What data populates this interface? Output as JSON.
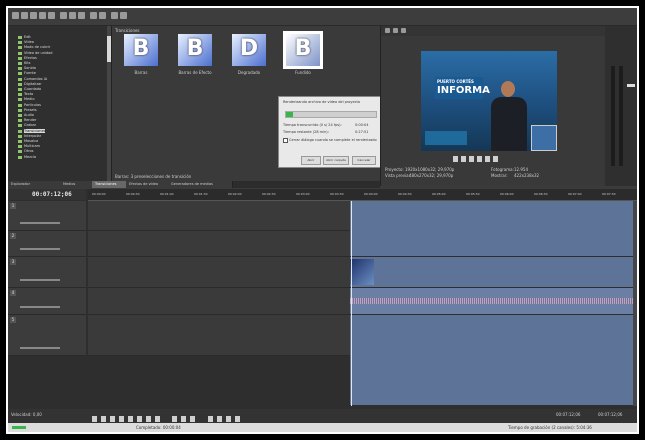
{
  "explorer": {
    "tree": [
      "Edit",
      "Vídeo",
      "Modo de cubrir",
      "Vídeo de unidad",
      "Efectos",
      "Kits",
      "Sonido",
      "Fuente",
      "Comandos IA",
      "Digitalizar",
      "Guardado",
      "Texto",
      "Medio",
      "Particulas",
      "Presets",
      "Audio",
      "Render",
      "Grabar",
      "Transiciones",
      "Interpolar",
      "Mosaico",
      "Multicam",
      "Otros",
      "Mezcla"
    ],
    "selected_index": 18
  },
  "transitions": {
    "header": "Transiciones",
    "items": [
      {
        "letter": "B",
        "label": "Barras"
      },
      {
        "letter": "B",
        "label": "Barras de Efecto"
      },
      {
        "letter": "D",
        "label": "Degradado"
      },
      {
        "letter": "B",
        "label": "Fundido"
      }
    ],
    "footer": "Barras: 3 preselecciones de transición"
  },
  "dialog": {
    "title": "Renderizando archivo de vídeo del proyecto",
    "progress": 0.08,
    "rows": [
      {
        "label": "Tiempo transcurrido (0 s/ 24 fps):",
        "value": "0:00:04"
      },
      {
        "label": "Tiempo restante (28 min):",
        "value": "0:27:51"
      }
    ],
    "checkbox_label": "Cerrar diálogo cuando se complete el renderizado",
    "buttons": [
      "Abrir",
      "Abrir carpeta",
      "Cancelar"
    ]
  },
  "preview": {
    "banner_line1": "PUERTO CORTÉS",
    "banner_line2": "INFORMA",
    "project_label": "Proyecto:",
    "project_value": "1920x1080x32; 29,970p",
    "preview_label": "Vista previa:",
    "preview_value": "480x270x32; 29,970p",
    "frame_label": "Fotograma:",
    "frame_value": "12.954",
    "display_label": "Mostrar:",
    "display_value": "422x238x32"
  },
  "tabs": [
    "Explorador",
    "Medios",
    "Transiciones",
    "Efectos de vídeo",
    "Generadores de medios"
  ],
  "active_tab": 2,
  "timeline": {
    "timecode": "00:07:12;06",
    "ruler_ticks": [
      "00:00:00",
      "00:00:30",
      "00:01:00",
      "00:01:30",
      "00:02:00",
      "00:02:30",
      "00:03:00",
      "00:03:30",
      "00:04:00",
      "00:04:30",
      "00:05:00",
      "00:05:30",
      "00:06:00",
      "00:06:30",
      "00:07:00",
      "00:07:30"
    ],
    "track_numbers": [
      "1",
      "2",
      "3",
      "4",
      "5"
    ]
  },
  "status": {
    "rate_label": "Velocidad: 0,00",
    "time_left": "Tiempo de grabación (2 canales): 5:04:36",
    "end": "00:07:12;06",
    "length": "00:07:12;06",
    "completed": "Completado: 00:00:04"
  },
  "colors": {
    "clip": "#5d7397",
    "progress": "#39b54a",
    "tree_icon": "#8fc66a",
    "accent": "#4c6fcf"
  }
}
